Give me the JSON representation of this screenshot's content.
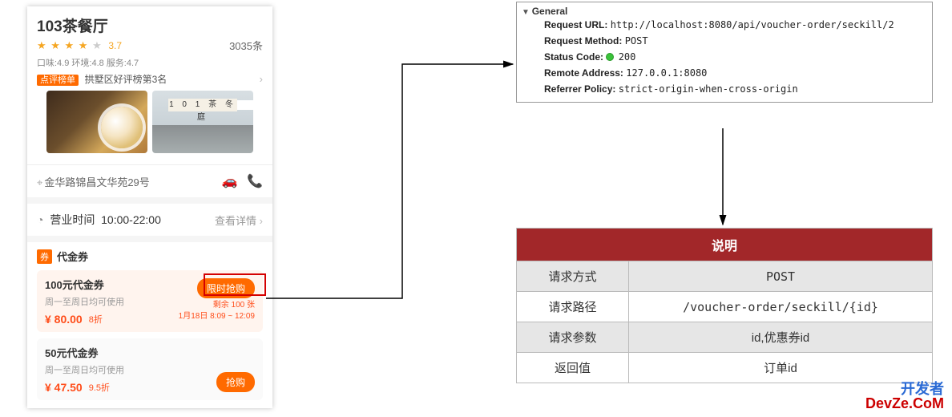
{
  "mobile": {
    "title": "103茶餐厅",
    "rating": "3.7",
    "review_count": "3035条",
    "sub_scores": "口味:4.9 环境:4.8 服务:4.7",
    "rank_badge": "点评榜单",
    "rank_text": "拱墅区好评榜第3名",
    "photo2_sign": "1 0 1 茶 冬 庭",
    "address": "金华路锦昌文华苑29号",
    "hours_label": "营业时间",
    "hours_value": "10:00-22:00",
    "hours_more": "查看详情",
    "voucher_tag": "券",
    "voucher_head": "代金券",
    "vouchers": [
      {
        "title": "100元代金券",
        "sub": "周一至周日均可使用",
        "price": "¥ 80.00",
        "discount": "8折",
        "btn": "限时抢购",
        "remain": "剩余 100 张",
        "window": "1月18日 8:09 ~ 12:09"
      },
      {
        "title": "50元代金券",
        "sub": "周一至周日均可使用",
        "price": "¥ 47.50",
        "discount": "9.5折",
        "btn": "抢购"
      }
    ]
  },
  "devtools": {
    "section": "General",
    "request_url_label": "Request URL:",
    "request_url": "http://localhost:8080/api/voucher-order/seckill/2",
    "request_method_label": "Request Method:",
    "request_method": "POST",
    "status_code_label": "Status Code:",
    "status_code": "200",
    "remote_addr_label": "Remote Address:",
    "remote_addr": "127.0.0.1:8080",
    "referrer_label": "Referrer Policy:",
    "referrer": "strict-origin-when-cross-origin"
  },
  "spec": {
    "header": "说明",
    "rows": [
      {
        "k": "请求方式",
        "v": "POST"
      },
      {
        "k": "请求路径",
        "v": "/voucher-order/seckill/{id}"
      },
      {
        "k": "请求参数",
        "v": "id,优惠券id"
      },
      {
        "k": "返回值",
        "v": "订单id"
      }
    ]
  },
  "watermark": {
    "line1": "开发者",
    "line2": "DevZe.CoM"
  }
}
